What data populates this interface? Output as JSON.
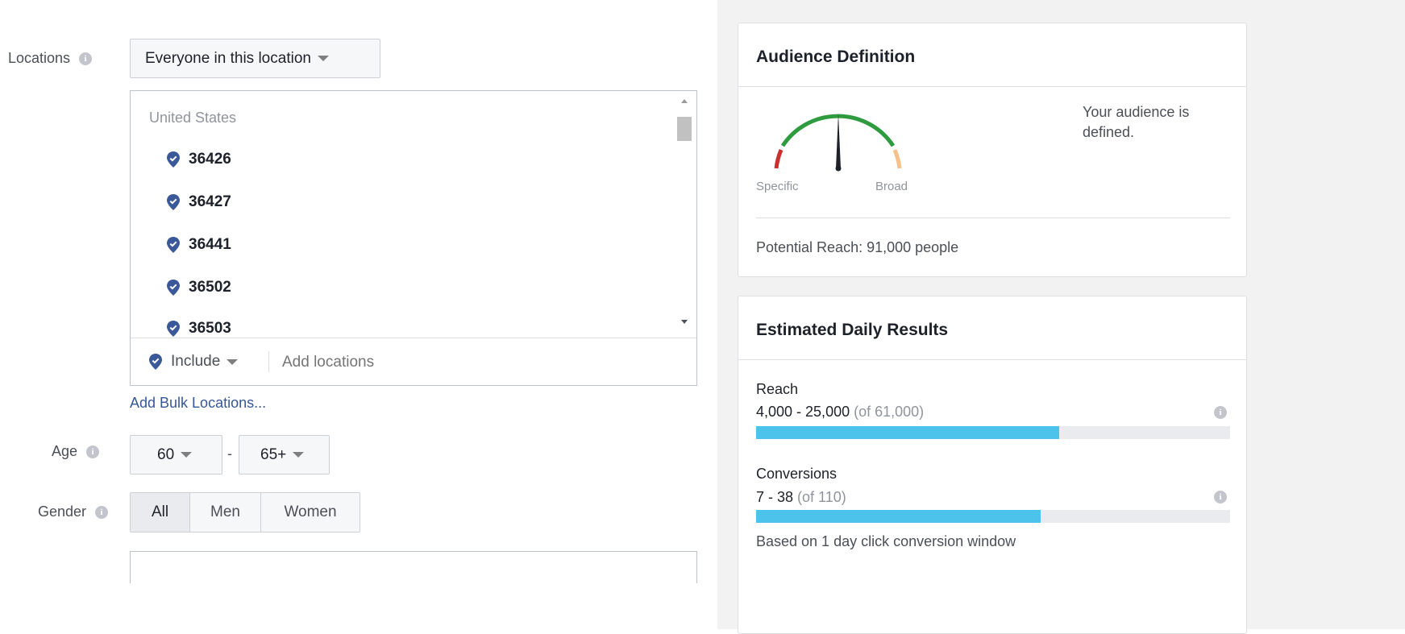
{
  "targeting": {
    "locations_label": "Locations",
    "location_type": "Everyone in this location",
    "country": "United States",
    "locations": [
      "36426",
      "36427",
      "36441",
      "36502",
      "36503"
    ],
    "include_label": "Include",
    "add_locations_placeholder": "Add locations",
    "bulk_link": "Add Bulk Locations...",
    "age_label": "Age",
    "age_min": "60",
    "age_separator": "-",
    "age_max": "65+",
    "gender_label": "Gender",
    "gender_options": [
      "All",
      "Men",
      "Women"
    ],
    "gender_selected": "All"
  },
  "audience": {
    "title": "Audience Definition",
    "status": "Your audience is defined.",
    "gauge_specific": "Specific",
    "gauge_broad": "Broad",
    "potential_reach": "Potential Reach: 91,000 people"
  },
  "results": {
    "title": "Estimated Daily Results",
    "metrics": [
      {
        "label": "Reach",
        "range": "4,000 - 25,000",
        "of": "(of 61,000)",
        "fill_fraction": 0.64
      },
      {
        "label": "Conversions",
        "range": "7 - 38",
        "of": "(of 110)",
        "fill_fraction": 0.6
      }
    ],
    "footnote": "Based on 1 day click conversion window"
  },
  "colors": {
    "accent_blue": "#4cc3ea",
    "link_blue": "#365899",
    "pin_blue": "#3b5998",
    "gauge_green": "#2e9b3e",
    "gauge_red": "#c8312e",
    "gauge_peach": "#f7c08a"
  }
}
